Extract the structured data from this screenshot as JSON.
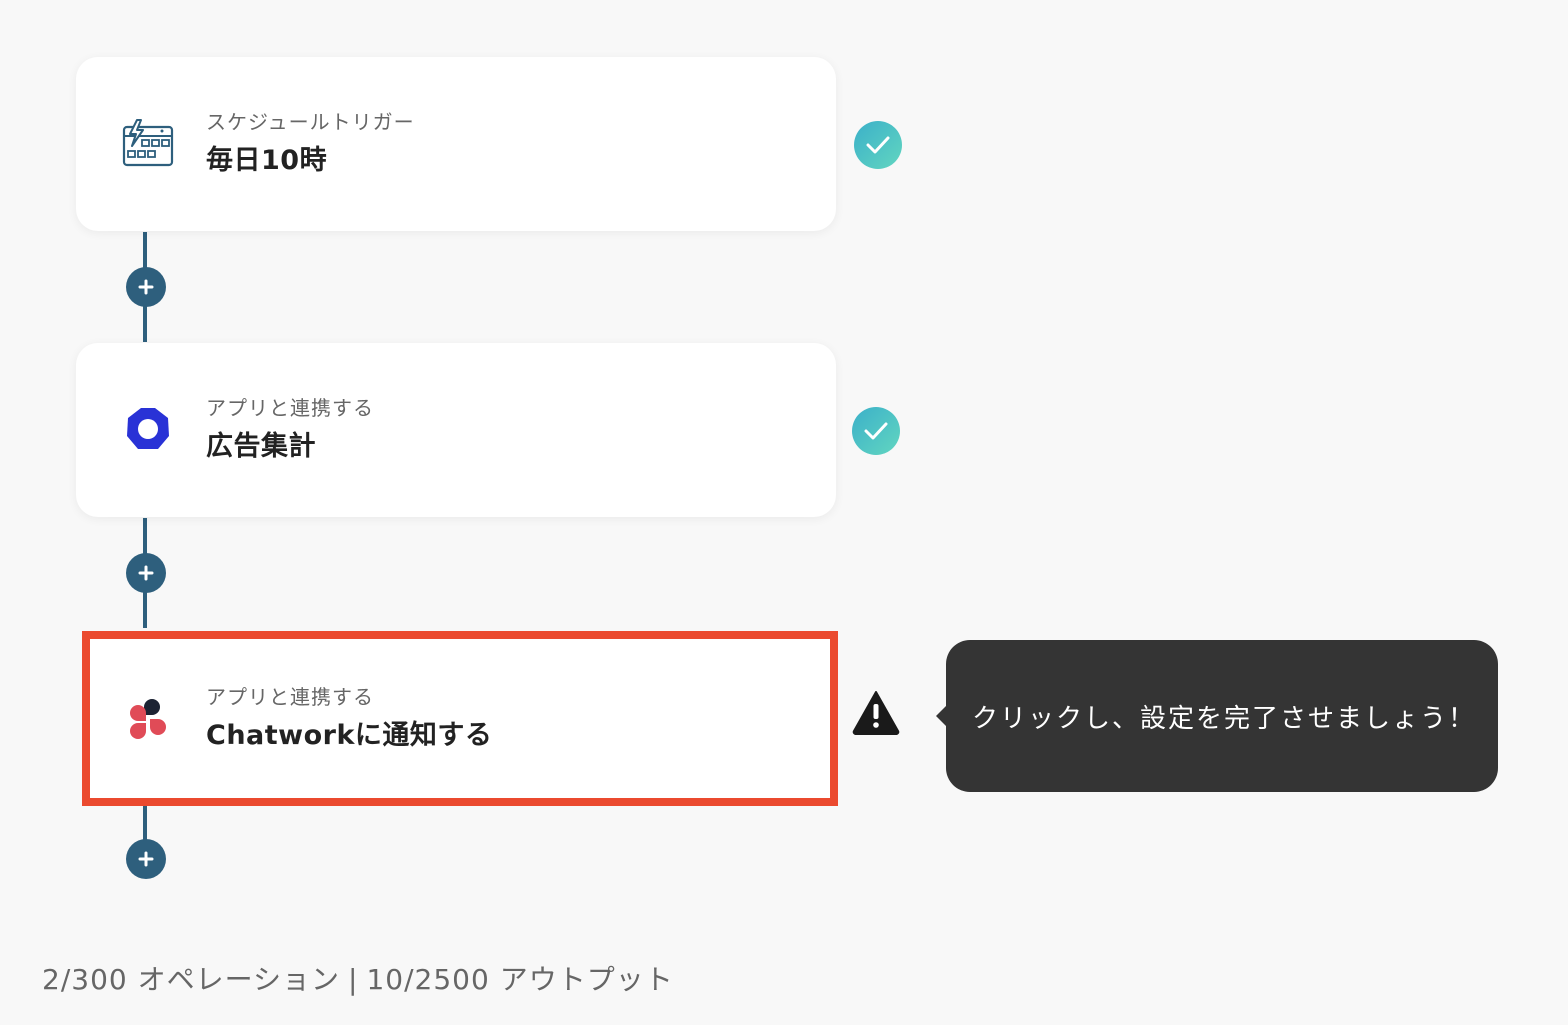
{
  "steps": [
    {
      "caption": "スケジュールトリガー",
      "title": "毎日10時",
      "icon": "calendar-lightning-icon",
      "status": "complete"
    },
    {
      "caption": "アプリと連携する",
      "title": "広告集計",
      "icon": "ad-aggregation-app-icon",
      "status": "complete"
    },
    {
      "caption": "アプリと連携する",
      "title": "Chatworkに通知する",
      "icon": "chatwork-logo-icon",
      "status": "warning"
    }
  ],
  "tooltip": {
    "text": "クリックし、設定を完了させましょう！"
  },
  "footer": {
    "operations": "2/300 オペレーション",
    "separator": "|",
    "outputs": "10/2500 アウトプット"
  },
  "colors": {
    "connector": "#2e5f7d",
    "highlight": "#eb4a2f",
    "check_gradient": [
      "#3bb0c9",
      "#62d6c0"
    ],
    "tooltip_bg": "#343434"
  }
}
